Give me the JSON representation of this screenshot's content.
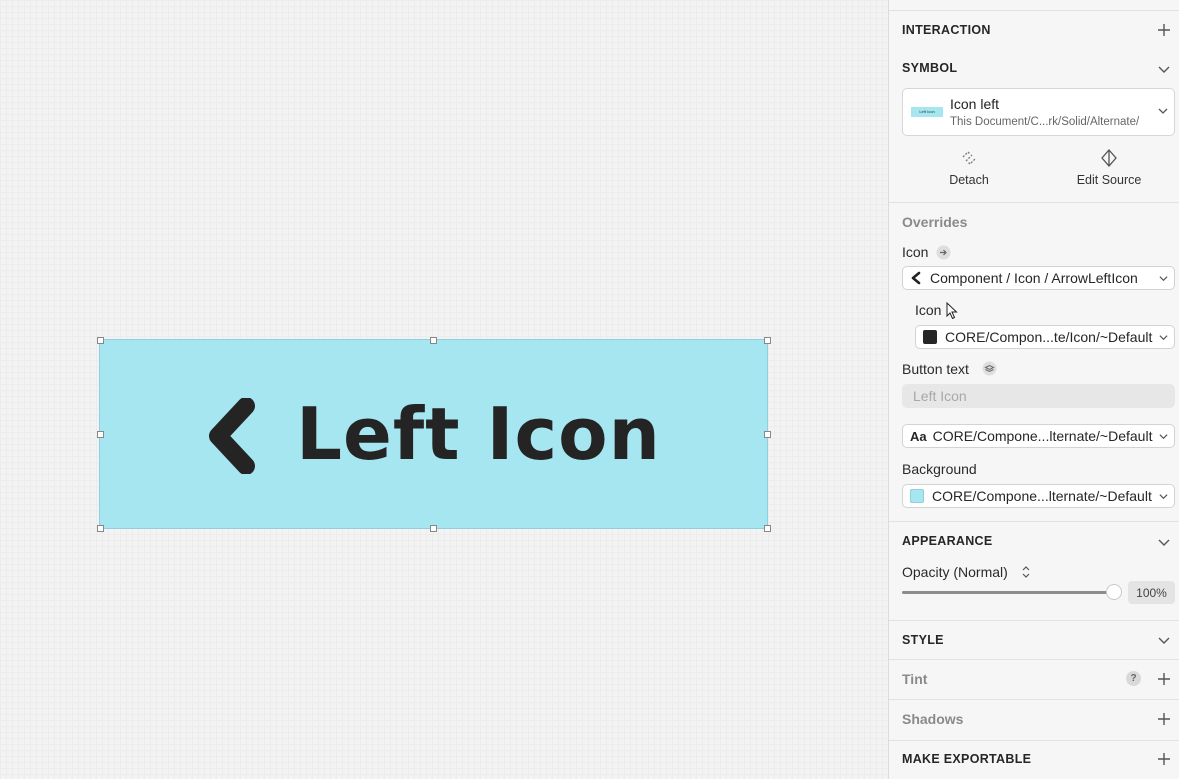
{
  "canvas": {
    "button_text": "Left Icon",
    "background_color": "#a6e6f0",
    "text_color": "#242424"
  },
  "panel": {
    "interaction": {
      "title": "INTERACTION"
    },
    "symbol": {
      "title": "SYMBOL",
      "thumb_text": "Left Icon",
      "name": "Icon left",
      "path": "This Document/C...rk/Solid/Alternate/",
      "detach_label": "Detach",
      "edit_source_label": "Edit Source"
    },
    "overrides": {
      "title": "Overrides",
      "icon_label": "Icon",
      "icon_value": "Component / Icon / ArrowLeftIcon",
      "nested_icon_label": "Icon",
      "nested_icon_value": "CORE/Compon...te/Icon/~Default",
      "button_text_label": "Button text",
      "button_text_placeholder": "Left Icon",
      "text_style_value": "CORE/Compone...lternate/~Default",
      "text_style_prefix": "Aa",
      "background_label": "Background",
      "background_value": "CORE/Compone...lternate/~Default",
      "background_swatch": "#a6e6f0",
      "icon_swatch": "#262626"
    },
    "appearance": {
      "title": "APPEARANCE",
      "opacity_label": "Opacity (Normal)",
      "opacity_value": "100%",
      "opacity_fraction": 1.0
    },
    "style": {
      "title": "STYLE",
      "tint_label": "Tint",
      "tint_help": "?",
      "shadows_label": "Shadows"
    },
    "export": {
      "title": "MAKE EXPORTABLE"
    }
  }
}
